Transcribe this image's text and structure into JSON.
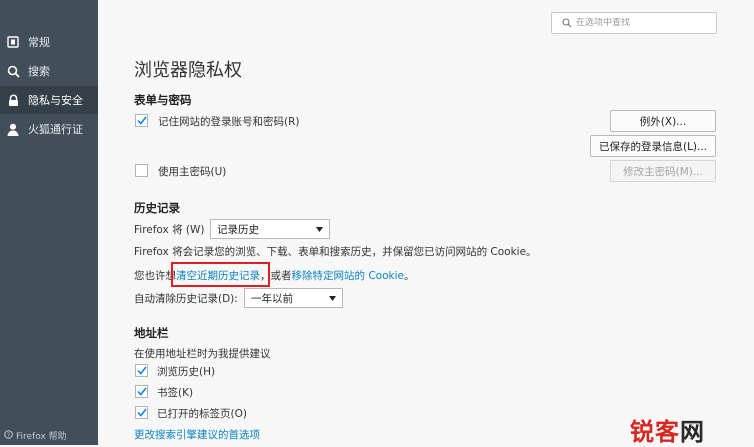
{
  "sidebar": {
    "items": [
      {
        "label": "常规",
        "icon": "general-icon",
        "active": false
      },
      {
        "label": "搜索",
        "icon": "search-icon",
        "active": false
      },
      {
        "label": "隐私与安全",
        "icon": "lock-icon",
        "active": true
      },
      {
        "label": "火狐通行证",
        "icon": "account-icon",
        "active": false
      }
    ],
    "help": "Firefox 帮助"
  },
  "search": {
    "placeholder": "在选项中查找"
  },
  "page_title": "浏览器隐私权",
  "forms": {
    "title": "表单与密码",
    "remember_label": "记住网站的登录账号和密码(R)",
    "remember_checked": true,
    "exceptions_button": "例外(X)...",
    "saved_logins_button": "已保存的登录信息(L)...",
    "master_password_label": "使用主密码(U)",
    "master_password_checked": false,
    "change_master_button": "修改主密码(M)..."
  },
  "history": {
    "title": "历史记录",
    "firefox_will_label": "Firefox 将 (W)",
    "mode_value": "记录历史",
    "description": "Firefox 将会记录您的浏览、下载、表单和搜索历史，并保留您已访问网站的 Cookie。",
    "allow_prefix": "您也许想",
    "clear_recent_link": "清空近期历史记录",
    "or_text": "，或者",
    "remove_cookies_link": "移除特定网站的 Cookie",
    "end_period": "。",
    "auto_clear_label": "自动清除历史记录(D):",
    "auto_clear_value": "一年以前"
  },
  "address_bar": {
    "title": "地址栏",
    "suggest_label": "在使用地址栏时为我提供建议",
    "options": [
      {
        "label": "浏览历史(H)",
        "checked": true
      },
      {
        "label": "书签(K)",
        "checked": true
      },
      {
        "label": "已打开的标签页(O)",
        "checked": true
      }
    ],
    "change_search_link": "更改搜索引擎建议的首选项"
  },
  "watermark": {
    "text_red": "锐客",
    "text_dark": "网"
  },
  "colors": {
    "sidebar_bg": "#424f5a",
    "link": "#0a84c6",
    "accent": "#0a84ff",
    "highlight_box": "#e02020"
  }
}
